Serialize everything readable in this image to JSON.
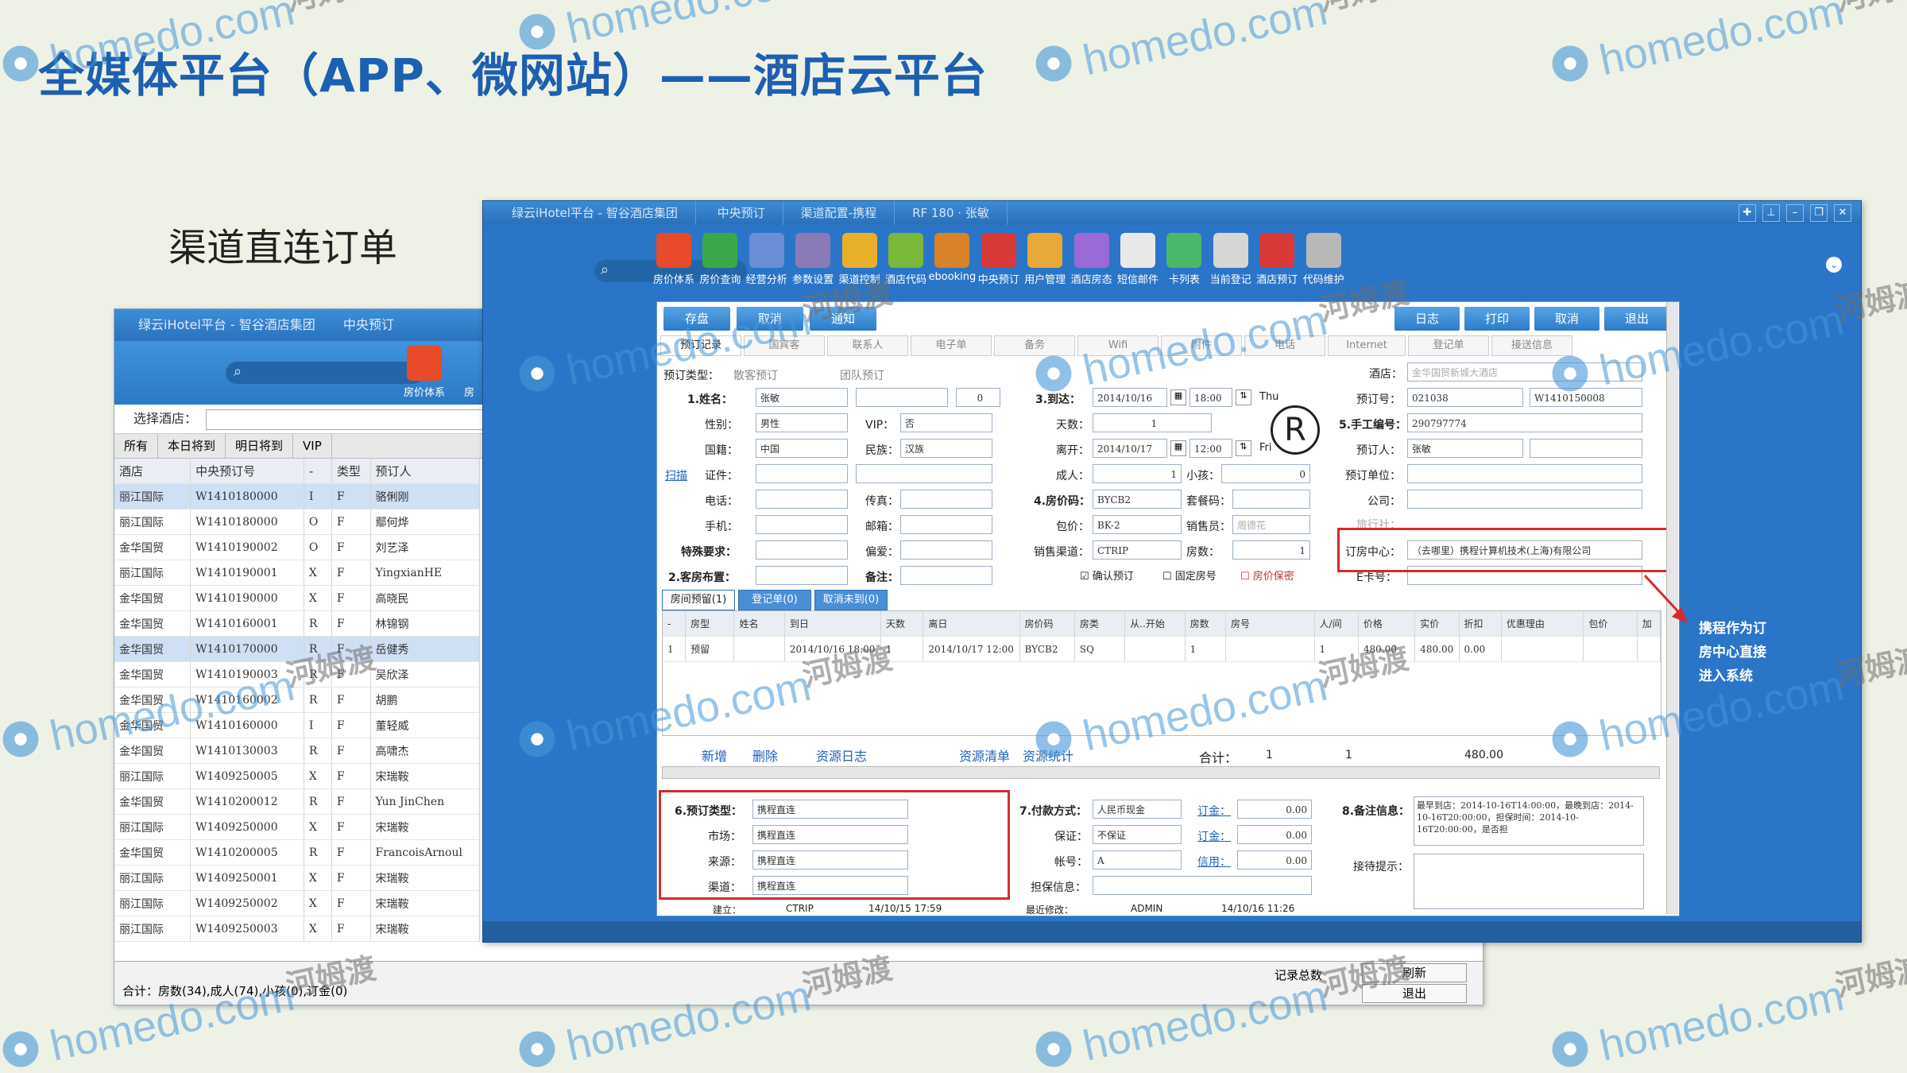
{
  "slide": {
    "title": "全媒体平台（APP、微网站）——酒店云平台",
    "subtitle": "渠道直连订单",
    "note_lines": [
      "携程作为订",
      "房中心直接",
      "进入系统"
    ]
  },
  "watermark": {
    "text": "homedo.com",
    "cn": "河姆渡"
  },
  "back_window": {
    "title": "绿云iHotel平台 - 智谷酒店集团",
    "title_tab": "中央预订",
    "toolbar_label": "房价体系",
    "toolbar_label2": "房",
    "hotel_select_label": "选择酒店：",
    "filters": [
      "所有",
      "本日将到",
      "明日将到",
      "VIP"
    ],
    "columns": [
      "酒店",
      "中央预订号",
      "-",
      "类型",
      "预订人"
    ],
    "rows": [
      [
        "丽江国际",
        "W1410180000",
        "I",
        "F",
        "骆俐刚"
      ],
      [
        "丽江国际",
        "W1410180000",
        "O",
        "F",
        "鄢何烨"
      ],
      [
        "金华国贸",
        "W1410190002",
        "O",
        "F",
        "刘艺泽"
      ],
      [
        "丽江国际",
        "W1410190001",
        "X",
        "F",
        "YingxianHE"
      ],
      [
        "金华国贸",
        "W1410190000",
        "X",
        "F",
        "高晓民"
      ],
      [
        "金华国贸",
        "W1410160001",
        "R",
        "F",
        "林锦钢"
      ],
      [
        "金华国贸",
        "W1410170000",
        "R",
        "F",
        "岳健秀"
      ],
      [
        "金华国贸",
        "W1410190003",
        "R",
        "F",
        "吴欣泽"
      ],
      [
        "金华国贸",
        "W1410160002",
        "R",
        "F",
        "胡鹏"
      ],
      [
        "金华国贸",
        "W1410160000",
        "I",
        "F",
        "董轻威"
      ],
      [
        "金华国贸",
        "W1410130003",
        "R",
        "F",
        "高啸杰"
      ],
      [
        "丽江国际",
        "W1409250005",
        "X",
        "F",
        "宋瑞鞍"
      ],
      [
        "金华国贸",
        "W1410200012",
        "R",
        "F",
        "Yun JinChen"
      ],
      [
        "丽江国际",
        "W1409250000",
        "X",
        "F",
        "宋瑞鞍"
      ],
      [
        "金华国贸",
        "W1410200005",
        "R",
        "F",
        "FrancoisArnoul"
      ],
      [
        "丽江国际",
        "W1409250001",
        "X",
        "F",
        "宋瑞鞍"
      ],
      [
        "丽江国际",
        "W1409250002",
        "X",
        "F",
        "宋瑞鞍"
      ],
      [
        "丽江国际",
        "W1409250003",
        "X",
        "F",
        "宋瑞鞍"
      ]
    ],
    "footer_summary": "合计：房数(34),成人(74),小孩(0),订金(0)",
    "footer_count": "记录总数",
    "footer_btn1": "刷新",
    "footer_btn2": "退出"
  },
  "front_window": {
    "title": "绿云iHotel平台 - 智谷酒店集团",
    "tabs": [
      "中央预订",
      "渠道配置-携程",
      "RF 180 · 张敏"
    ],
    "window_controls": [
      "✚",
      "⊥",
      "–",
      "❐",
      "✕"
    ],
    "toolbar": [
      "房价体系",
      "房价查询",
      "经营分析",
      "参数设置",
      "渠道控制",
      "酒店代码",
      "ebooking",
      "中央预订",
      "用户管理",
      "酒店房态",
      "短信邮件",
      "卡列表",
      "当前登记",
      "酒店预订",
      "代码维护"
    ],
    "toolbar_colors": [
      "#e84a2a",
      "#3aa84a",
      "#6a8ed6",
      "#8a7ab8",
      "#e8b02a",
      "#7ab83a",
      "#d8822a",
      "#d83a3a",
      "#e8a83a",
      "#9a6ad6",
      "#e8e8e8",
      "#4ab86a",
      "#d6d6d6",
      "#d83a3a",
      "#b8b8b8"
    ],
    "action_buttons_left": [
      "存盘",
      "取消",
      "通知"
    ],
    "action_buttons_right": [
      "日志",
      "打印",
      "取消",
      "退出"
    ],
    "form_tabs": [
      "预订记录",
      "国宾客",
      "联系人",
      "电子单",
      "备务",
      "Wifi",
      "附件",
      "电话",
      "Internet",
      "登记单",
      "接送信息"
    ],
    "fields": {
      "reserve_type": "预订类型：",
      "reserve_individual": "散客预订",
      "reserve_group": "团队预订",
      "name_lbl": "1.姓名：",
      "name": "张敏",
      "count_val": "0",
      "gender_lbl": "性别：",
      "gender": "男性",
      "vip_lbl": "VIP：",
      "vip": "否",
      "nation_lbl": "国籍：",
      "nation": "中国",
      "ethnic_lbl": "民族：",
      "ethnic": "汉族",
      "scan_lbl": "扫描",
      "id_lbl": "证件：",
      "phone_lbl": "电话：",
      "fax_lbl": "传真：",
      "mobile_lbl": "手机：",
      "email_lbl": "邮箱：",
      "special_lbl": "特殊要求：",
      "pref_lbl": "偏爱：",
      "layout_lbl": "2.客房布置：",
      "remark_lbl": "备注：",
      "arrive_lbl": "3.到达：",
      "arrive_date": "2014/10/16",
      "arrive_time": "18:00",
      "arrive_day": "Thu",
      "nights_lbl": "天数：",
      "nights": "1",
      "depart_lbl": "离开：",
      "depart_date": "2014/10/17",
      "depart_time": "12:00",
      "depart_day": "Fri",
      "adults_lbl": "成人：",
      "adults": "1",
      "kids_lbl": "小孩：",
      "kids": "0",
      "rate_lbl": "4.房价码：",
      "rate": "BYCB2",
      "rate_code_lbl": "套餐码：",
      "pkg_lbl": "包价：",
      "pkg": "BK-2",
      "sales_lbl": "销售员：",
      "sales": "周德花",
      "channel_lbl": "销售渠道：",
      "channel": "CTRIP",
      "rooms_lbl": "房数：",
      "rooms": "1",
      "check_confirm": "确认预订",
      "check_fixed": "固定房号",
      "check_secret": "房价保密",
      "hotel_lbl": "酒店：",
      "hotel": "金华国贸新城大酒店",
      "order_no_lbl": "预订号：",
      "order_no": "021038",
      "order_no2": "W1410150008",
      "manual_lbl": "5.手工编号：",
      "manual": "290797774",
      "booker_lbl": "预订人：",
      "booker": "张敏",
      "unit_lbl": "预订单位：",
      "company_lbl": "公司：",
      "agent_lbl": "旅行社：",
      "center_lbl": "订房中心：",
      "center": "（去哪里）携程计算机技术(上海)有限公司",
      "card_lbl": "E卡号："
    },
    "sub_tabs": [
      "房间预留(1)",
      "登记单(0)",
      "取消未到(0)"
    ],
    "room_columns": [
      "-",
      "房型",
      "姓名",
      "到日",
      "天数",
      "离日",
      "房价码",
      "房类",
      "从..开始",
      "房数",
      "房号",
      "人/间",
      "价格",
      "实价",
      "折扣",
      "优惠理由",
      "包价",
      "加"
    ],
    "room_row": [
      "1",
      "预留",
      "",
      "2014/10/16 18:00",
      "1",
      "2014/10/17 12:00",
      "BYCB2",
      "SQ",
      "",
      "1",
      "",
      "1",
      "480.00",
      "480.00",
      "0.00",
      "",
      "",
      ""
    ],
    "room_links": [
      "新增",
      "删除",
      "资源日志",
      "资源清单",
      "资源统计"
    ],
    "totals_lbl": "合计：",
    "totals": [
      "1",
      "1",
      "480.00"
    ],
    "bottom": {
      "type_lbl": "6.预订类型：",
      "type": "携程直连",
      "market_lbl": "市场：",
      "market": "携程直连",
      "source_lbl": "来源：",
      "source": "携程直连",
      "channel_lbl": "渠道：",
      "channel": "携程直连",
      "creator_lbl": "建立：",
      "creator": "CTRIP",
      "created": "14/10/15 17:59",
      "pay_lbl": "7.付款方式：",
      "pay": "人民币现金",
      "deposit_lbl": "订金：",
      "deposit": "0.00",
      "guarantee_lbl": "保证：",
      "guarantee": "不保证",
      "deposit2_lbl": "订金：",
      "deposit2": "0.00",
      "acct_lbl": "帐号：",
      "acct": "A",
      "credit_lbl": "信用：",
      "credit": "0.00",
      "payinfo_lbl": "担保信息：",
      "modifier_lbl": "最近修改：",
      "modifier": "ADMIN",
      "modified": "14/10/16 11:26",
      "memo_lbl": "8.备注信息：",
      "memo": "最早到店：2014-10-16T14:00:00，最晚到店：2014-10-16T20:00:00，担保时间：2014-10-16T20:00:00，是否担",
      "prompt_lbl": "接待提示："
    },
    "registered_mark": "R"
  }
}
